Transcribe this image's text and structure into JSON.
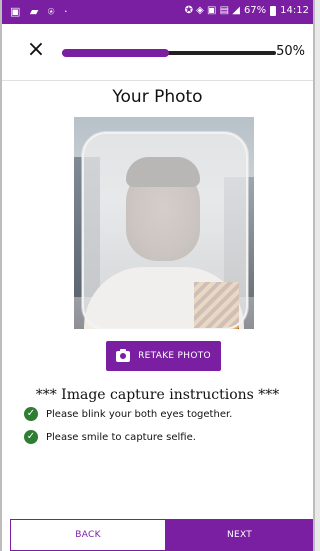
{
  "status_bar": {
    "left_icons": "▣ ▰ ⍟ ·",
    "battery": "67%",
    "time": "14:12",
    "signal_icons": "✪ ◈ ▣ ▤ ◢",
    "bg_color": "#7b1fa2"
  },
  "header": {
    "close_icon": "×",
    "progress_percent": 50,
    "progress_label": "50%"
  },
  "title": "Your Photo",
  "retake_button": {
    "label": "RETAKE PHOTO",
    "icon": "camera-icon"
  },
  "instructions": {
    "title": "*** Image capture instructions ***",
    "items": [
      {
        "text": "Please blink your both eyes together.",
        "icon": "check-icon"
      },
      {
        "text": "Please smile to capture selfie.",
        "icon": "check-icon"
      }
    ]
  },
  "footer": {
    "back_label": "BACK",
    "next_label": "NEXT"
  },
  "colors": {
    "accent": "#7b1fa2",
    "success": "#2e7d32"
  }
}
